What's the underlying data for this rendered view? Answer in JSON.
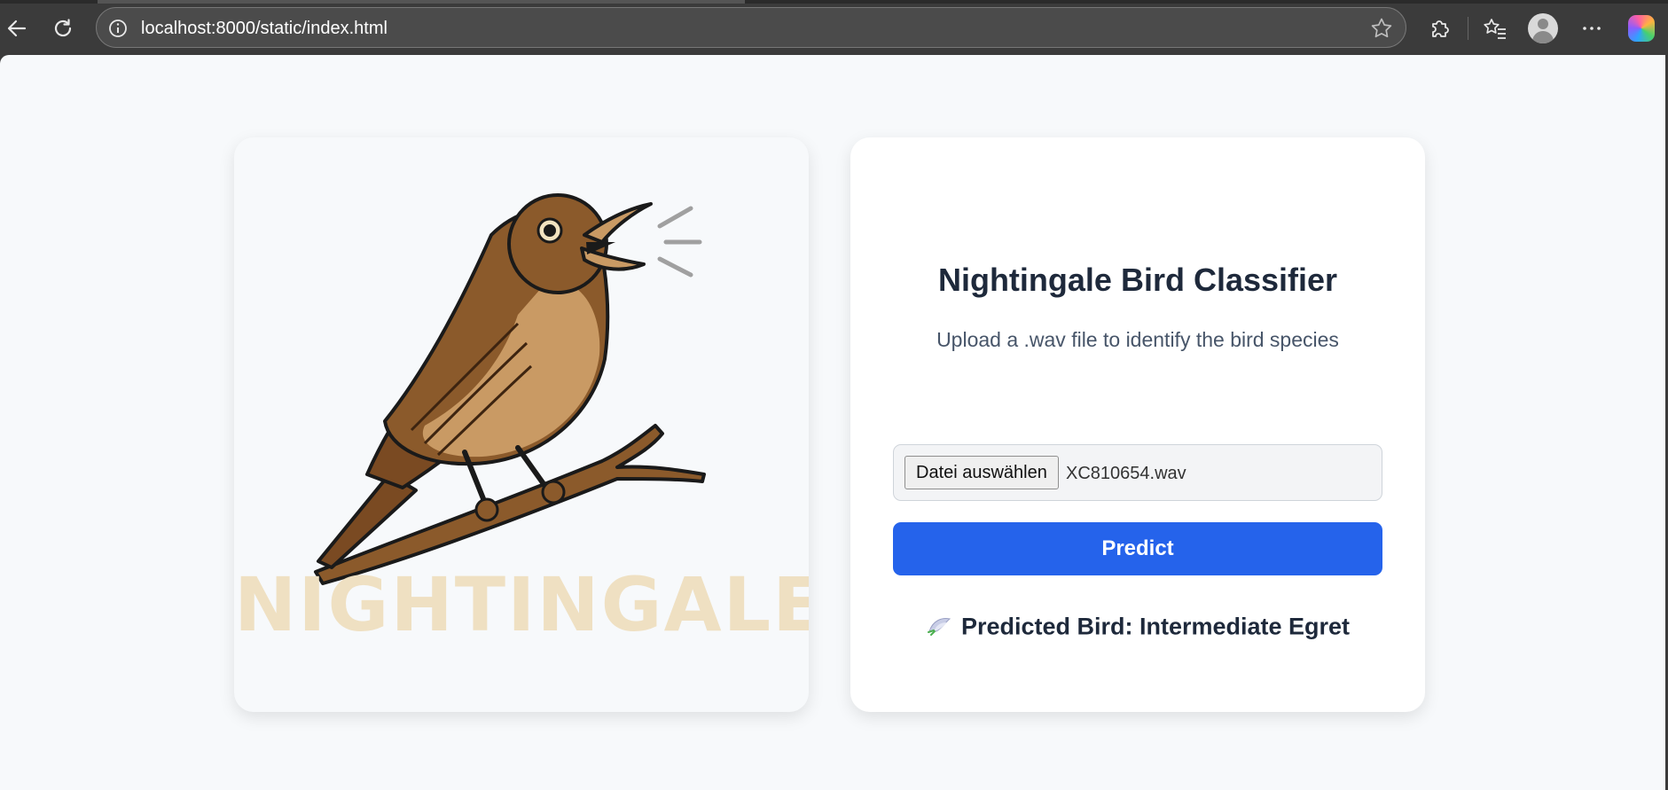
{
  "browser": {
    "url": "localhost:8000/static/index.html"
  },
  "icons": {
    "back": "back-arrow-icon",
    "reload": "reload-icon",
    "info": "info-icon",
    "favorite": "star-icon",
    "extensions": "puzzle-icon",
    "favorites_list": "favorites-list-icon",
    "profile": "profile-avatar-icon",
    "more": "more-dots-icon",
    "copilot": "copilot-icon"
  },
  "logo": {
    "text": "NIGHTINGALE"
  },
  "classifier": {
    "title": "Nightingale Bird Classifier",
    "subtitle": "Upload a .wav file to identify the bird species",
    "file_button": "Datei auswählen",
    "file_name": "XC810654.wav",
    "predict_label": "Predict",
    "result_text": "Predicted Bird: Intermediate Egret"
  },
  "colors": {
    "accent": "#2563eb",
    "page_bg": "#f7f9fb",
    "heading": "#1e293b",
    "bird_body": "#8b5a2b",
    "bird_breast": "#c99a64"
  }
}
